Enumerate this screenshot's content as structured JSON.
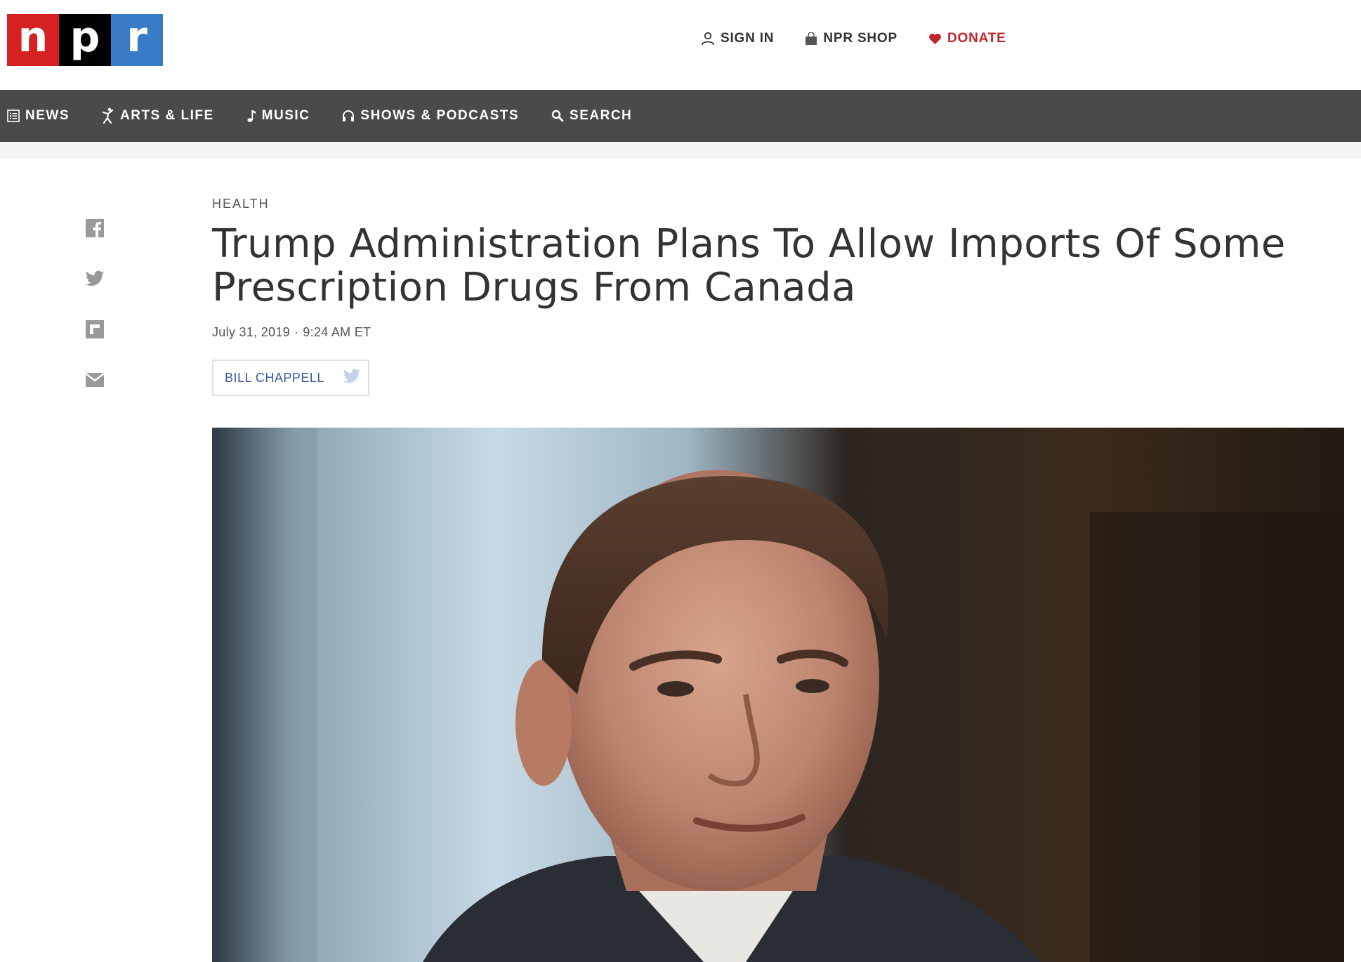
{
  "brand": {
    "letters": [
      "n",
      "p",
      "r"
    ],
    "colors": [
      "#d62021",
      "#000000",
      "#3a7bc8"
    ]
  },
  "utility_nav": {
    "sign_in": "SIGN IN",
    "shop": "NPR SHOP",
    "donate": "DONATE",
    "donate_color": "#c0252c"
  },
  "main_nav": {
    "background": "#4a4a4a",
    "items": [
      {
        "label": "NEWS",
        "icon": "news-list-icon"
      },
      {
        "label": "ARTS & LIFE",
        "icon": "dancer-icon"
      },
      {
        "label": "MUSIC",
        "icon": "music-note-icon"
      },
      {
        "label": "SHOWS & PODCASTS",
        "icon": "headphones-icon"
      },
      {
        "label": "SEARCH",
        "icon": "search-icon"
      }
    ]
  },
  "share": [
    "facebook-icon",
    "twitter-icon",
    "flipboard-icon",
    "email-icon"
  ],
  "article": {
    "section": "HEALTH",
    "headline": "Trump Administration Plans To Allow Imports Of Some Prescription Drugs From Canada",
    "date": "July 31, 2019",
    "separator": "·",
    "time": "9:24 AM ET",
    "author": "BILL CHAPPELL",
    "author_color": "#3a5a9c"
  }
}
